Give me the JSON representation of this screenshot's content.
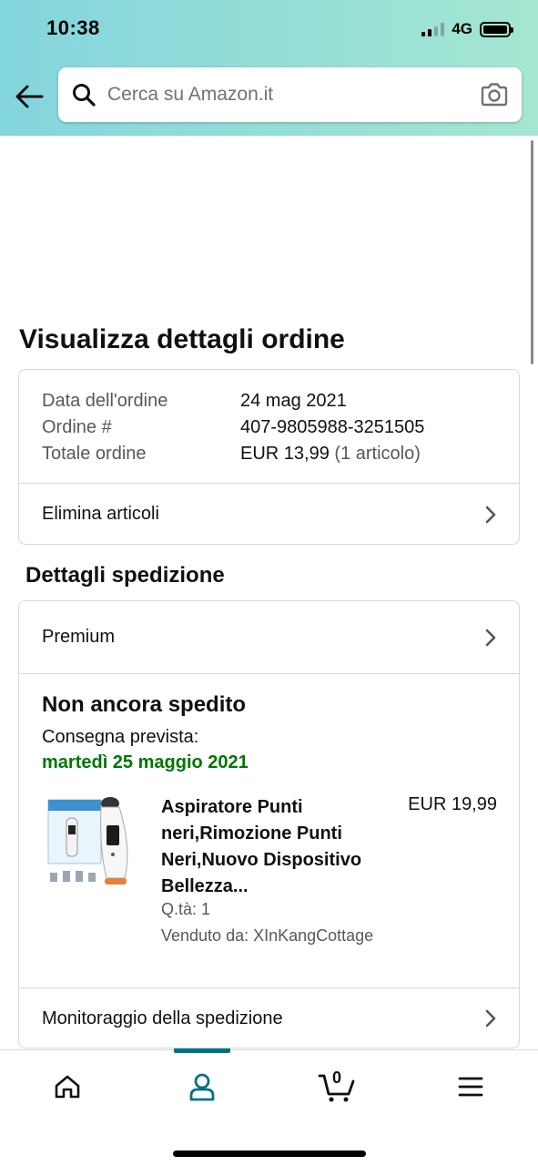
{
  "status_bar": {
    "time": "10:38",
    "network": "4G"
  },
  "search": {
    "placeholder": "Cerca su Amazon.it"
  },
  "page": {
    "title": "Visualizza dettagli ordine"
  },
  "order_info": {
    "rows": [
      {
        "label": "Data dell'ordine",
        "value": "24 mag 2021",
        "sub": ""
      },
      {
        "label": "Ordine #",
        "value": "407-9805988-3251505",
        "sub": ""
      },
      {
        "label": "Totale ordine",
        "value": "EUR 13,99",
        "sub": "(1 articolo)"
      }
    ],
    "delete_items_label": "Elimina articoli"
  },
  "shipping": {
    "section_title": "Dettagli spedizione",
    "premium_label": "Premium",
    "status_title": "Non ancora spedito",
    "estimated_label": "Consegna prevista:",
    "estimated_date": "martedì 25 maggio 2021",
    "colors": {
      "date": "#007600"
    },
    "product": {
      "name": "Aspiratore Punti neri,Rimozione Punti Neri,Nuovo Dispositivo Bellezza...",
      "price": "EUR 19,99",
      "qty": "Q.tà: 1",
      "seller": "Venduto da: XInKangCottage"
    },
    "tracking_label": "Monitoraggio della spedizione"
  },
  "bottom_nav": {
    "items": [
      {
        "icon": "home-icon"
      },
      {
        "icon": "account-icon",
        "active": true
      },
      {
        "icon": "cart-icon",
        "count": "0"
      },
      {
        "icon": "menu-icon"
      }
    ],
    "accent": "#007185"
  }
}
